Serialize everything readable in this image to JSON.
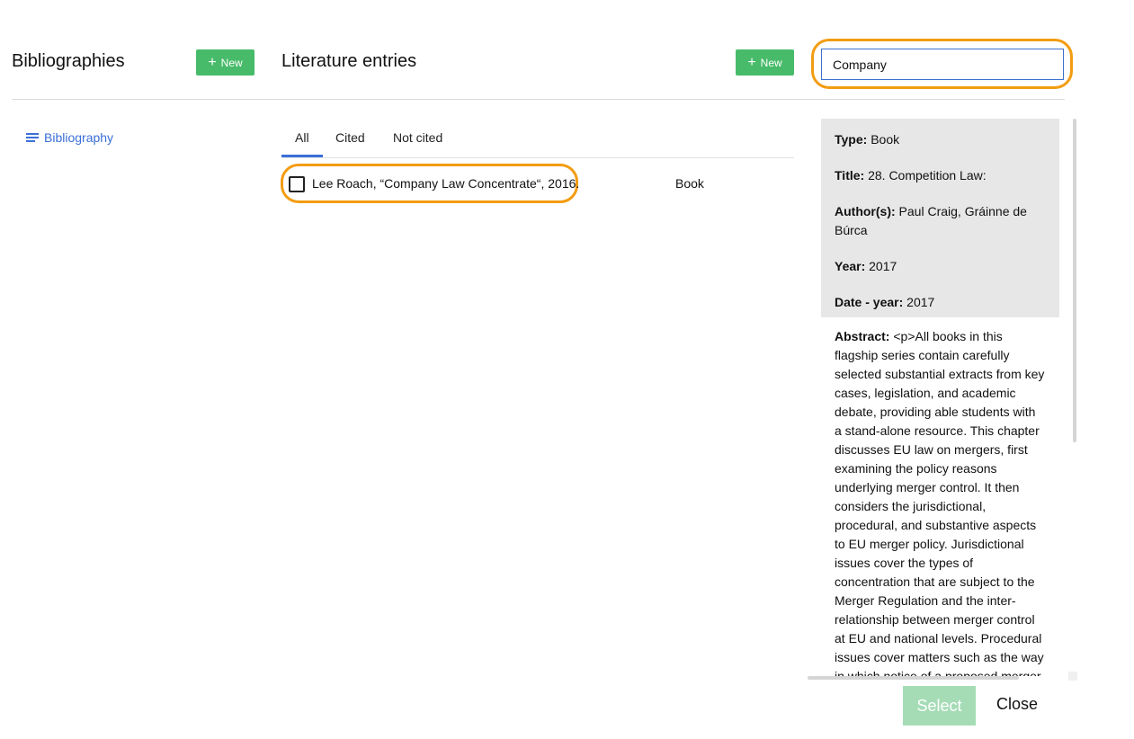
{
  "bibliographies": {
    "title": "Bibliographies",
    "new_label": "New",
    "items": [
      {
        "label": "Bibliography",
        "icon": "list-icon"
      }
    ]
  },
  "literature": {
    "title": "Literature entries",
    "new_label": "New",
    "tabs": [
      {
        "label": "All"
      },
      {
        "label": "Cited"
      },
      {
        "label": "Not cited"
      }
    ],
    "active_tab": "All",
    "entries": [
      {
        "text": "Lee Roach, “Company Law Concentrate“, 2016.",
        "type": "Book",
        "checked": false
      }
    ]
  },
  "search": {
    "value": "Company"
  },
  "details": {
    "type_label": "Type:",
    "type_value": "Book",
    "title_label": "Title:",
    "title_value": "28. Competition Law:",
    "authors_label": "Author(s):",
    "authors_value": "Paul Craig, Gráinne de Búrca",
    "year_label": "Year:",
    "year_value": "2017",
    "date_label": "Date - year:",
    "date_value": "2017",
    "abstract_label": "Abstract:",
    "abstract_value": "<p>All books in this flagship series contain carefully selected substantial extracts from key cases, legislation, and academic debate, providing able students with a stand-alone resource. This chapter discusses EU law on mergers, first examining the policy reasons underlying merger control. It then considers the jurisdictional, procedural, and substantive aspects to EU merger policy. Jurisdictional issues cover the types of concentration that are subject to the Merger Regulation and the inter-relationship between merger control at EU and national levels. Procedural issues cover matters such as the way in which notice of a proposed merger"
  },
  "footer": {
    "select_label": "Select",
    "close_label": "Close"
  },
  "colors": {
    "accent": "#3b6fd8",
    "new_button": "#48bb6a",
    "highlight": "#f39c12",
    "select_disabled": "#a5dcb6"
  }
}
